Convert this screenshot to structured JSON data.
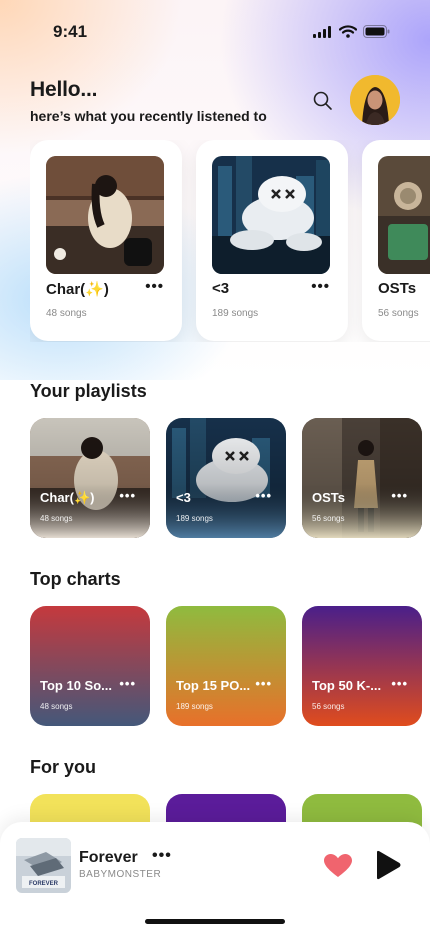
{
  "status_bar": {
    "time": "9:41"
  },
  "header": {
    "greeting": "Hello...",
    "subtitle": "here’s what you recently listened to"
  },
  "recent": [
    {
      "name": "Char(✨)",
      "count": "48 songs",
      "more": "•••"
    },
    {
      "name": "<3",
      "count": "189 songs",
      "more": "•••"
    },
    {
      "name": "OSTs",
      "count": "56 songs",
      "more": "•••"
    }
  ],
  "sections": {
    "playlists": "Your playlists",
    "top_charts": "Top charts",
    "for_you": "For you"
  },
  "playlists": [
    {
      "name": "Char(✨)",
      "count": "48 songs",
      "more": "•••"
    },
    {
      "name": "<3",
      "count": "189 songs",
      "more": "•••"
    },
    {
      "name": "OSTs",
      "count": "56 songs",
      "more": "•••"
    }
  ],
  "charts": [
    {
      "name": "Top 10 So...",
      "count": "48 songs",
      "more": "•••",
      "colors": [
        "#c5393d",
        "#44587a"
      ]
    },
    {
      "name": "Top 15 PO...",
      "count": "189 songs",
      "more": "•••",
      "colors": [
        "#8fbb3f",
        "#e8702a"
      ]
    },
    {
      "name": "Top 50 K-...",
      "count": "56 songs",
      "more": "•••",
      "colors": [
        "#4a1f8a",
        "#e04c1d"
      ]
    }
  ],
  "for_you_colors": [
    "#f2e25a",
    "#5b1c9a",
    "#8fbb3f"
  ],
  "player": {
    "song": "Forever",
    "artist": "BABYMONSTER",
    "more": "•••",
    "cover_text": "FOREVER"
  },
  "colors": {
    "heart": "#f0646e",
    "accent_bg": "#a8a0fa"
  }
}
